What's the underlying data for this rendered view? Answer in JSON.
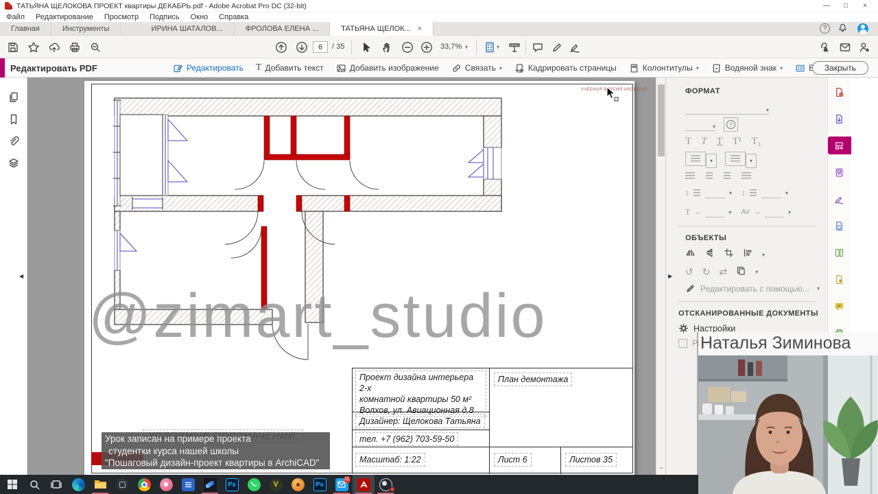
{
  "window": {
    "title": "ТАТЬЯНА ЩЕЛОКОВА ПРОЕКТ квартиры ДЕКАБРЬ.pdf - Adobe Acrobat Pro DC (32-bit)"
  },
  "glyphs": {
    "caret": "▾",
    "close_tab": "×",
    "minimize": "—",
    "maximize": "□",
    "close": "×",
    "help": "?",
    "left": "◀",
    "right": "▶",
    "down": "⌄",
    "rot_ccw": "↺",
    "rot_cw": "↻",
    "swap": "⇄",
    "updown": "↕",
    "h_arrow": "↔",
    "t": "T",
    "t_sup": "T¹",
    "t_sub": "T₁",
    "t_width": "T",
    "av": "AV"
  },
  "menubar": {
    "items": [
      "Файл",
      "Редактирование",
      "Просмотр",
      "Подпись",
      "Окно",
      "Справка"
    ]
  },
  "tabbar": {
    "tabs": [
      "Главная",
      "Инструменты",
      "ИРИНА ШАТАЛОВ...",
      "ФРОЛОВА ЕЛЕНА ...",
      "ТАТЬЯНА ЩЕЛОК..."
    ]
  },
  "toolbar": {
    "page": "6",
    "pages": "/ 35",
    "zoom": "33,7%"
  },
  "edit_bar": {
    "title": "Редактировать PDF",
    "edit": "Редактировать",
    "add_text": "Добавить текст",
    "add_image": "Добавить изображение",
    "link": "Связать",
    "crop": "Кадрировать страницы",
    "header": "Колонтитулы",
    "watermark": "Водяной знак",
    "more": "Еще",
    "close": "Закрыть"
  },
  "right_panel": {
    "format": "ФОРМАТ",
    "objects": "ОБЪЕКТЫ",
    "edit_with": "Редактировать с помощью...",
    "scanned": "ОТСКАНИРОВАННЫЕ ДОКУМЕНТЫ",
    "settings": "Настройки",
    "recognize": "Распознавать текст"
  },
  "page": {
    "archicad": "УЧЕБНАЯ ВЕРСИЯ ARCHICAD",
    "watermark": "@zimart_studio",
    "legend": "УСЛОВНЫЕ ОБОЗНАЧЕНИЯ:",
    "titleblock": {
      "project1": "Проект дизайна интерьера 2-х",
      "project2": "комнатной квартиры 50 м²",
      "project3": "Волхов, ул. Авиационная д.8",
      "plan": "План демонтажа",
      "designer": "Дизайнер: Щелокова Татьяна",
      "phone": "тел. +7 (962) 703-59-50",
      "scale": "Масштаб: 1:22",
      "sheet": "Лист 6",
      "sheets": "Листов 35"
    }
  },
  "caption": {
    "l1": "Урок записан на примере проекта",
    "l2": "студентки курса нашей школы",
    "l3": "\"Пошаговый дизайн-проект квартиры в ArchiCAD\""
  },
  "webcam": {
    "name": "Наталья Зиминова"
  },
  "taskbar": {
    "ps": "Ps",
    "badge": "11",
    "v": "V"
  },
  "colors": {
    "accent_magenta": "#b5006e",
    "wall_red": "#c40606",
    "window_purple": "#7a6bc8",
    "link_blue": "#1272c3"
  }
}
